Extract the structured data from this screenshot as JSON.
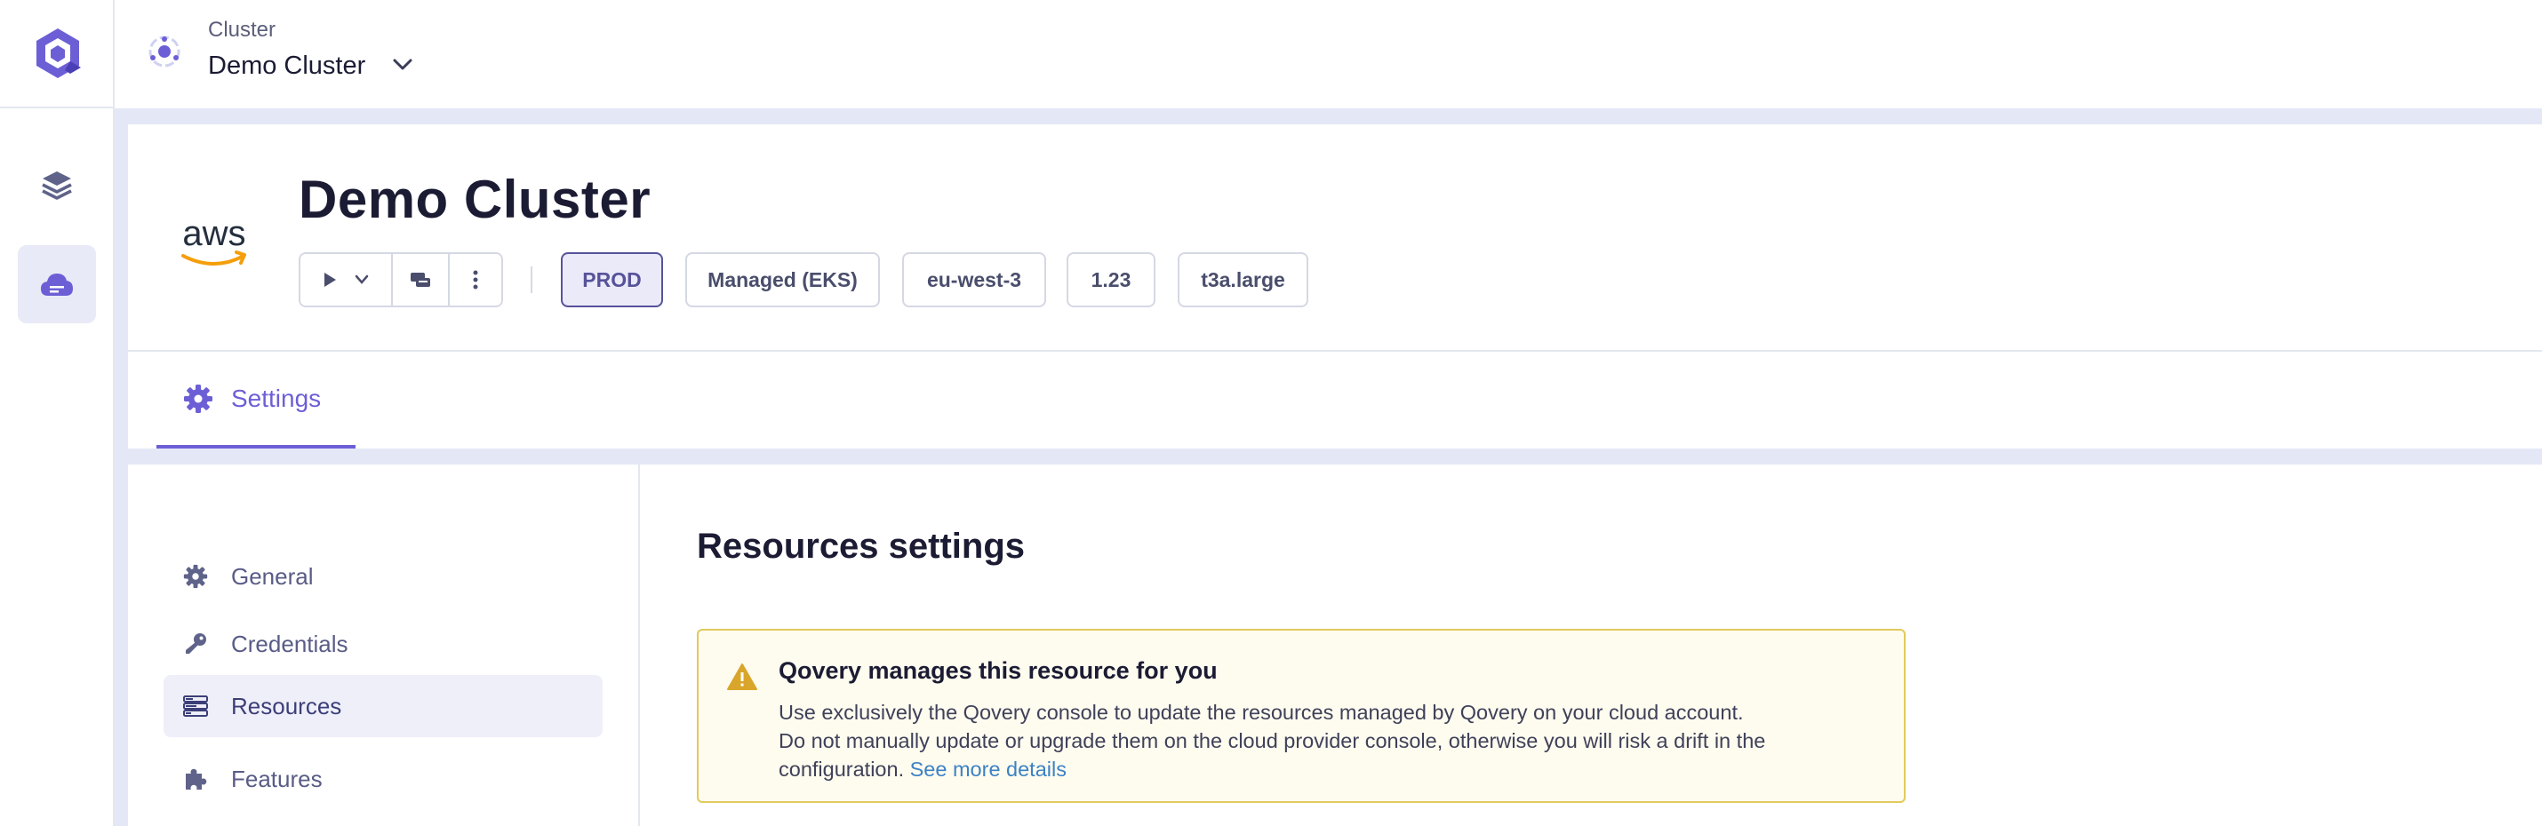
{
  "topbar": {
    "cluster_label": "Cluster",
    "cluster_name": "Demo Cluster"
  },
  "header": {
    "title": "Demo Cluster",
    "provider_logo_text": "aws",
    "tags": {
      "environment": "PROD",
      "type": "Managed (EKS)",
      "region": "eu-west-3",
      "version": "1.23",
      "instance": "t3a.large"
    },
    "tab_settings": "Settings"
  },
  "sidebar_nav": {
    "items": [
      {
        "label": "General",
        "icon": "gear-icon"
      },
      {
        "label": "Credentials",
        "icon": "key-icon"
      },
      {
        "label": "Resources",
        "icon": "resources-icon",
        "active": true
      },
      {
        "label": "Features",
        "icon": "puzzle-icon"
      }
    ]
  },
  "main": {
    "section_title": "Resources settings",
    "callout": {
      "title": "Qovery manages this resource for you",
      "line1": "Use exclusively the Qovery console to update the resources managed by Qovery on your cloud account.",
      "line2": "Do not manually update or upgrade them on the cloud provider console, otherwise you will risk a drift in the configuration.",
      "link": "See more details"
    }
  },
  "colors": {
    "accent": "#6c5fd6",
    "warning": "#d9a52a",
    "link": "#3b82c4"
  }
}
